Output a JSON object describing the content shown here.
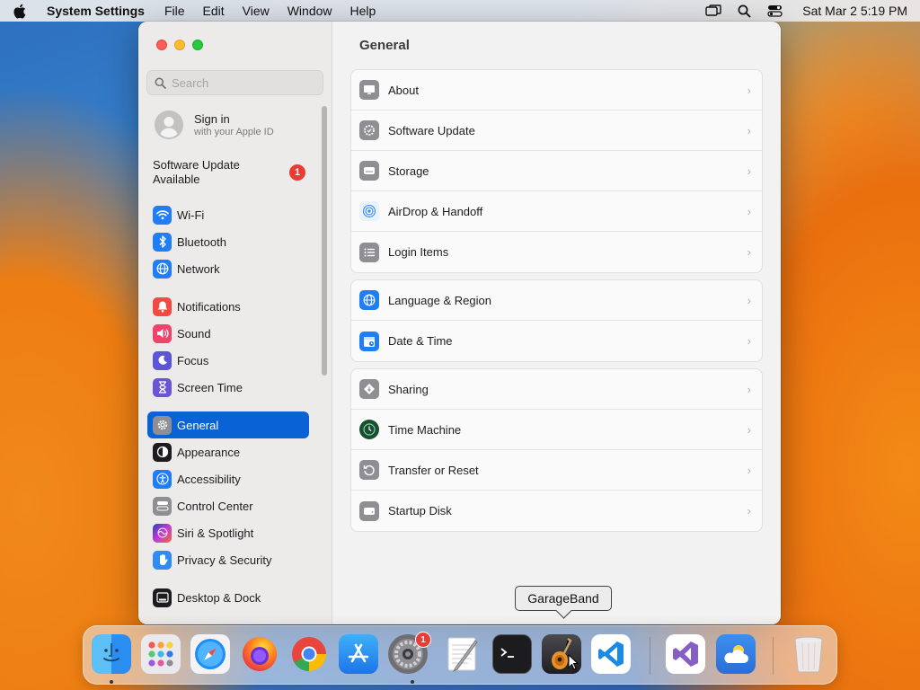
{
  "menubar": {
    "app_name": "System Settings",
    "menus": [
      "File",
      "Edit",
      "View",
      "Window",
      "Help"
    ],
    "clock": "Sat Mar 2  5:19 PM"
  },
  "search": {
    "placeholder": "Search",
    "value": ""
  },
  "account": {
    "title": "Sign in",
    "subtitle": "with your Apple ID"
  },
  "update_notice": {
    "label": "Software Update Available",
    "badge": "1"
  },
  "sidebar": {
    "groups": [
      [
        {
          "label": "Wi-Fi",
          "icon": "wifi-icon",
          "color": "#1f7ef5"
        },
        {
          "label": "Bluetooth",
          "icon": "bluetooth-icon",
          "color": "#1f7ef5"
        },
        {
          "label": "Network",
          "icon": "globe-icon",
          "color": "#1f7ef5"
        }
      ],
      [
        {
          "label": "Notifications",
          "icon": "bell-icon",
          "color": "#f04a43"
        },
        {
          "label": "Sound",
          "icon": "speaker-icon",
          "color": "#f0426b"
        },
        {
          "label": "Focus",
          "icon": "moon-icon",
          "color": "#5b55d8"
        },
        {
          "label": "Screen Time",
          "icon": "hourglass-icon",
          "color": "#6a55d6"
        }
      ],
      [
        {
          "label": "General",
          "icon": "gear-icon",
          "color": "#8e8e93",
          "active": true
        },
        {
          "label": "Appearance",
          "icon": "appearance-icon",
          "color": "#1c1c1e"
        },
        {
          "label": "Accessibility",
          "icon": "accessibility-icon",
          "color": "#1f7ef5"
        },
        {
          "label": "Control Center",
          "icon": "control-center-icon",
          "color": "#8e8e93"
        },
        {
          "label": "Siri & Spotlight",
          "icon": "siri-icon",
          "color": "#7b3fbe"
        },
        {
          "label": "Privacy & Security",
          "icon": "hand-icon",
          "color": "#2f8cf5"
        }
      ],
      [
        {
          "label": "Desktop & Dock",
          "icon": "dock-icon",
          "color": "#1c1c1e"
        }
      ]
    ]
  },
  "main": {
    "title": "General",
    "cards": [
      [
        {
          "label": "About",
          "icon": "computer-icon",
          "color": "#8e8e93"
        },
        {
          "label": "Software Update",
          "icon": "software-update-icon",
          "color": "#8e8e93"
        },
        {
          "label": "Storage",
          "icon": "storage-icon",
          "color": "#8e8e93"
        },
        {
          "label": "AirDrop & Handoff",
          "icon": "airdrop-icon",
          "color": "#2f8cf5"
        },
        {
          "label": "Login Items",
          "icon": "list-icon",
          "color": "#8e8e93"
        }
      ],
      [
        {
          "label": "Language & Region",
          "icon": "globe-icon",
          "color": "#1f7ef5"
        },
        {
          "label": "Date & Time",
          "icon": "calendar-clock-icon",
          "color": "#1f7ef5"
        }
      ],
      [
        {
          "label": "Sharing",
          "icon": "sharing-icon",
          "color": "#8e8e93"
        },
        {
          "label": "Time Machine",
          "icon": "time-machine-icon",
          "color": "#2b7a4b"
        },
        {
          "label": "Transfer or Reset",
          "icon": "reset-icon",
          "color": "#8e8e93"
        },
        {
          "label": "Startup Disk",
          "icon": "disk-icon",
          "color": "#8e8e93"
        }
      ]
    ]
  },
  "dock": {
    "tooltip": "GarageBand",
    "apps": [
      {
        "name": "Finder",
        "icon": "finder-icon",
        "running": true
      },
      {
        "name": "Launchpad",
        "icon": "launchpad-icon"
      },
      {
        "name": "Safari",
        "icon": "safari-icon"
      },
      {
        "name": "Firefox",
        "icon": "firefox-icon"
      },
      {
        "name": "Chrome",
        "icon": "chrome-icon"
      },
      {
        "name": "App Store",
        "icon": "app-store-icon"
      },
      {
        "name": "System Settings",
        "icon": "system-settings-icon",
        "running": true,
        "badge": "1"
      },
      {
        "name": "TextEdit",
        "icon": "textedit-icon"
      },
      {
        "name": "Terminal",
        "icon": "terminal-icon"
      },
      {
        "name": "GarageBand",
        "icon": "garageband-icon"
      },
      {
        "name": "Visual Studio Code",
        "icon": "vscode-icon"
      },
      {
        "name": "Visual Studio",
        "icon": "visual-studio-icon"
      },
      {
        "name": "Weather",
        "icon": "weather-icon"
      },
      {
        "name": "Trash",
        "icon": "trash-icon"
      }
    ]
  }
}
